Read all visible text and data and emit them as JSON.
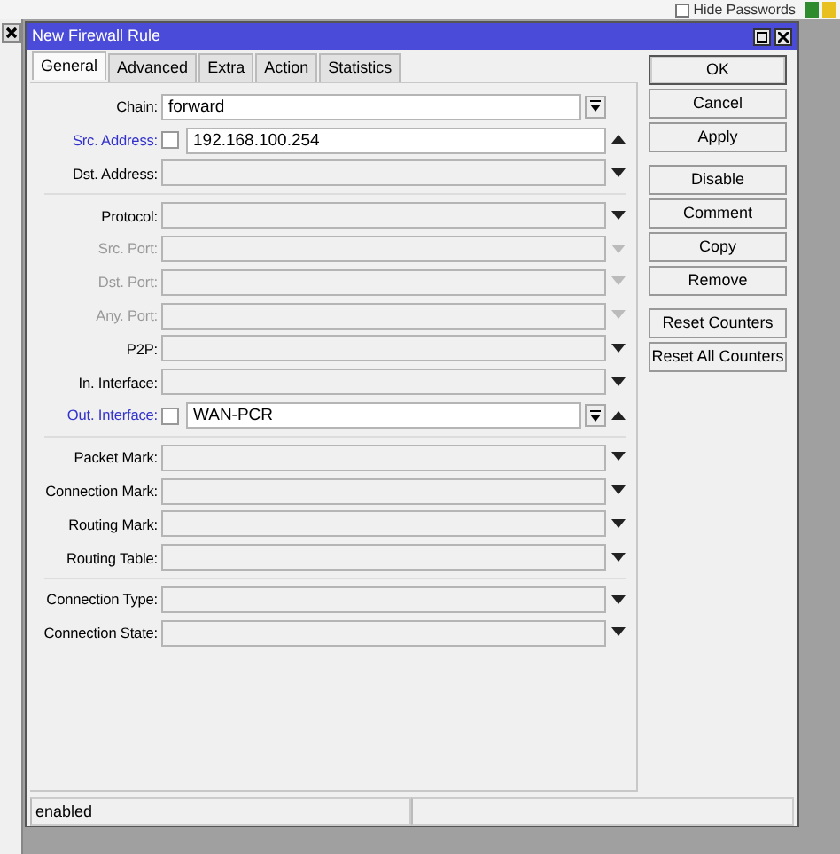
{
  "top_bar": {
    "hide_passwords": {
      "label": "Hide Passwords",
      "checked": false
    }
  },
  "window": {
    "title": "New Firewall Rule"
  },
  "tabs": [
    {
      "label": "General",
      "selected": true
    },
    {
      "label": "Advanced",
      "selected": false
    },
    {
      "label": "Extra",
      "selected": false
    },
    {
      "label": "Action",
      "selected": false
    },
    {
      "label": "Statistics",
      "selected": false
    }
  ],
  "sections": [
    {
      "fields": [
        {
          "label": "Chain:",
          "value": "forward",
          "kind": "select",
          "active": false,
          "disabled": false
        },
        {
          "label": "Src. Address:",
          "value": "192.168.100.254",
          "kind": "text",
          "expanded": true,
          "negate": {
            "checked": false
          },
          "active": true,
          "disabled": false
        },
        {
          "label": "Dst. Address:",
          "kind": "text",
          "expanded": false,
          "active": false,
          "disabled": false
        }
      ]
    },
    {
      "fields": [
        {
          "label": "Protocol:",
          "kind": "text",
          "expanded": false,
          "active": false,
          "disabled": false
        },
        {
          "label": "Src. Port:",
          "kind": "text",
          "expanded": false,
          "active": false,
          "disabled": true
        },
        {
          "label": "Dst. Port:",
          "kind": "text",
          "expanded": false,
          "active": false,
          "disabled": true
        },
        {
          "label": "Any. Port:",
          "kind": "text",
          "expanded": false,
          "active": false,
          "disabled": true
        },
        {
          "label": "P2P:",
          "kind": "text",
          "expanded": false,
          "active": false,
          "disabled": false
        },
        {
          "label": "In. Interface:",
          "kind": "text",
          "expanded": false,
          "active": false,
          "disabled": false
        },
        {
          "label": "Out. Interface:",
          "value": "WAN-PCR",
          "kind": "select",
          "expanded": true,
          "negate": {
            "checked": false
          },
          "active": true,
          "disabled": false
        }
      ]
    },
    {
      "fields": [
        {
          "label": "Packet Mark:",
          "kind": "text",
          "expanded": false,
          "active": false,
          "disabled": false
        },
        {
          "label": "Connection Mark:",
          "kind": "text",
          "expanded": false,
          "active": false,
          "disabled": false
        },
        {
          "label": "Routing Mark:",
          "kind": "text",
          "expanded": false,
          "active": false,
          "disabled": false
        },
        {
          "label": "Routing Table:",
          "kind": "text",
          "expanded": false,
          "active": false,
          "disabled": false
        }
      ]
    },
    {
      "fields": [
        {
          "label": "Connection Type:",
          "kind": "text",
          "expanded": false,
          "active": false,
          "disabled": false
        },
        {
          "label": "Connection State:",
          "kind": "text",
          "expanded": false,
          "active": false,
          "disabled": false
        }
      ]
    }
  ],
  "button_groups": [
    [
      {
        "label": "OK",
        "default": true
      },
      {
        "label": "Cancel",
        "default": false
      },
      {
        "label": "Apply",
        "default": false
      }
    ],
    [
      {
        "label": "Disable",
        "default": false
      },
      {
        "label": "Comment",
        "default": false
      },
      {
        "label": "Copy",
        "default": false
      },
      {
        "label": "Remove",
        "default": false
      }
    ],
    [
      {
        "label": "Reset Counters",
        "default": false
      },
      {
        "label": "Reset All Counters",
        "default": false
      }
    ]
  ],
  "status_bar": {
    "text": "enabled"
  }
}
